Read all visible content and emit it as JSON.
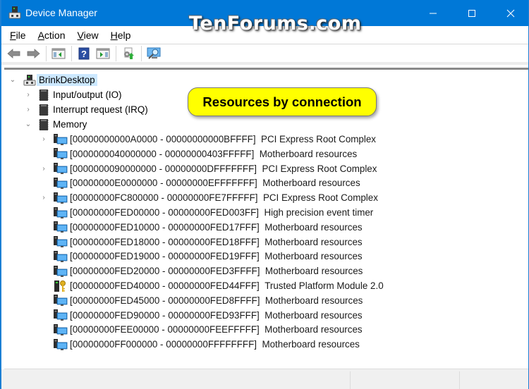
{
  "window": {
    "title": "Device Manager",
    "watermark": "TenForums.com",
    "accent_color": "#0078d7",
    "controls": [
      "minimize",
      "maximize",
      "close"
    ]
  },
  "menu": [
    {
      "label": "File",
      "accel": "F",
      "rest": "ile"
    },
    {
      "label": "Action",
      "accel": "A",
      "rest": "ction"
    },
    {
      "label": "View",
      "accel": "V",
      "rest": "iew"
    },
    {
      "label": "Help",
      "accel": "H",
      "rest": "elp"
    }
  ],
  "toolbar": [
    {
      "icon": "back-arrow-icon",
      "tooltip": "Back"
    },
    {
      "icon": "forward-arrow-icon",
      "tooltip": "Forward"
    },
    {
      "icon": "show-hide-console-tree-icon",
      "tooltip": "Show/Hide Console Tree"
    },
    {
      "icon": "help-icon",
      "tooltip": "Help"
    },
    {
      "icon": "show-hide-action-pane-icon",
      "tooltip": "Show/Hide Action Pane"
    },
    {
      "icon": "update-driver-icon",
      "tooltip": "Update Driver"
    },
    {
      "icon": "scan-hardware-icon",
      "tooltip": "Scan for hardware changes"
    }
  ],
  "callout": "Resources by connection",
  "tree": {
    "root": {
      "label": "BrinkDesktop",
      "expanded": true,
      "selected": true
    },
    "categories": [
      {
        "label": "Input/output (IO)",
        "expanded": false
      },
      {
        "label": "Interrupt request (IRQ)",
        "expanded": false
      },
      {
        "label": "Memory",
        "expanded": true
      }
    ],
    "memory_entries": [
      {
        "range": "[00000000000A0000 - 00000000000BFFFF]",
        "device": "PCI Express Root Complex",
        "expandable": true,
        "icon": "computer"
      },
      {
        "range": "[0000000040000000 - 00000000403FFFFF]",
        "device": "Motherboard resources",
        "expandable": false,
        "icon": "computer"
      },
      {
        "range": "[0000000090000000 - 00000000DFFFFFFF]",
        "device": "PCI Express Root Complex",
        "expandable": true,
        "icon": "computer"
      },
      {
        "range": "[00000000E0000000 - 00000000EFFFFFFF]",
        "device": "Motherboard resources",
        "expandable": false,
        "icon": "computer"
      },
      {
        "range": "[00000000FC800000 - 00000000FE7FFFFF]",
        "device": "PCI Express Root Complex",
        "expandable": true,
        "icon": "computer"
      },
      {
        "range": "[00000000FED00000 - 00000000FED003FF]",
        "device": "High precision event timer",
        "expandable": false,
        "icon": "computer"
      },
      {
        "range": "[00000000FED10000 - 00000000FED17FFF]",
        "device": "Motherboard resources",
        "expandable": false,
        "icon": "computer"
      },
      {
        "range": "[00000000FED18000 - 00000000FED18FFF]",
        "device": "Motherboard resources",
        "expandable": false,
        "icon": "computer"
      },
      {
        "range": "[00000000FED19000 - 00000000FED19FFF]",
        "device": "Motherboard resources",
        "expandable": false,
        "icon": "computer"
      },
      {
        "range": "[00000000FED20000 - 00000000FED3FFFF]",
        "device": "Motherboard resources",
        "expandable": false,
        "icon": "computer"
      },
      {
        "range": "[00000000FED40000 - 00000000FED44FFF]",
        "device": "Trusted Platform Module 2.0",
        "expandable": false,
        "icon": "security-key"
      },
      {
        "range": "[00000000FED45000 - 00000000FED8FFFF]",
        "device": "Motherboard resources",
        "expandable": false,
        "icon": "computer"
      },
      {
        "range": "[00000000FED90000 - 00000000FED93FFF]",
        "device": "Motherboard resources",
        "expandable": false,
        "icon": "computer"
      },
      {
        "range": "[00000000FEE00000 - 00000000FEEFFFFF]",
        "device": "Motherboard resources",
        "expandable": false,
        "icon": "computer"
      },
      {
        "range": "[00000000FF000000 - 00000000FFFFFFFF]",
        "device": "Motherboard resources",
        "expandable": false,
        "icon": "computer"
      }
    ]
  }
}
